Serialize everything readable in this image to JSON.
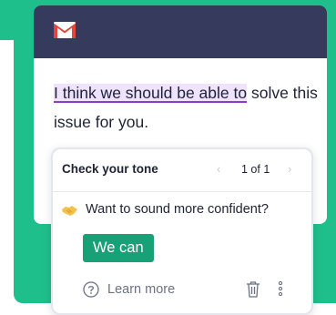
{
  "colors": {
    "brand_green": "#1fbf8c",
    "header_navy": "#363a5c",
    "highlight_purple": "#efe2fb",
    "underline_purple": "#8a3ec7",
    "cta_green": "#18a077"
  },
  "email": {
    "app_icon": "gmail-icon",
    "highlighted_text": "I think we should be able to",
    "rest_text": " solve this issue for you."
  },
  "tone_card": {
    "title": "Check your tone",
    "pager": {
      "prev": "‹",
      "count": "1 of 1",
      "next": "›"
    },
    "suggestion_icon": "handshake-icon",
    "suggestion_text": "Want to sound more confident?",
    "replacement": "We can",
    "learn_more": "Learn more",
    "help_icon": "question-circle-icon",
    "dismiss_icon": "trash-icon",
    "more_icon": "kebab-icon"
  }
}
